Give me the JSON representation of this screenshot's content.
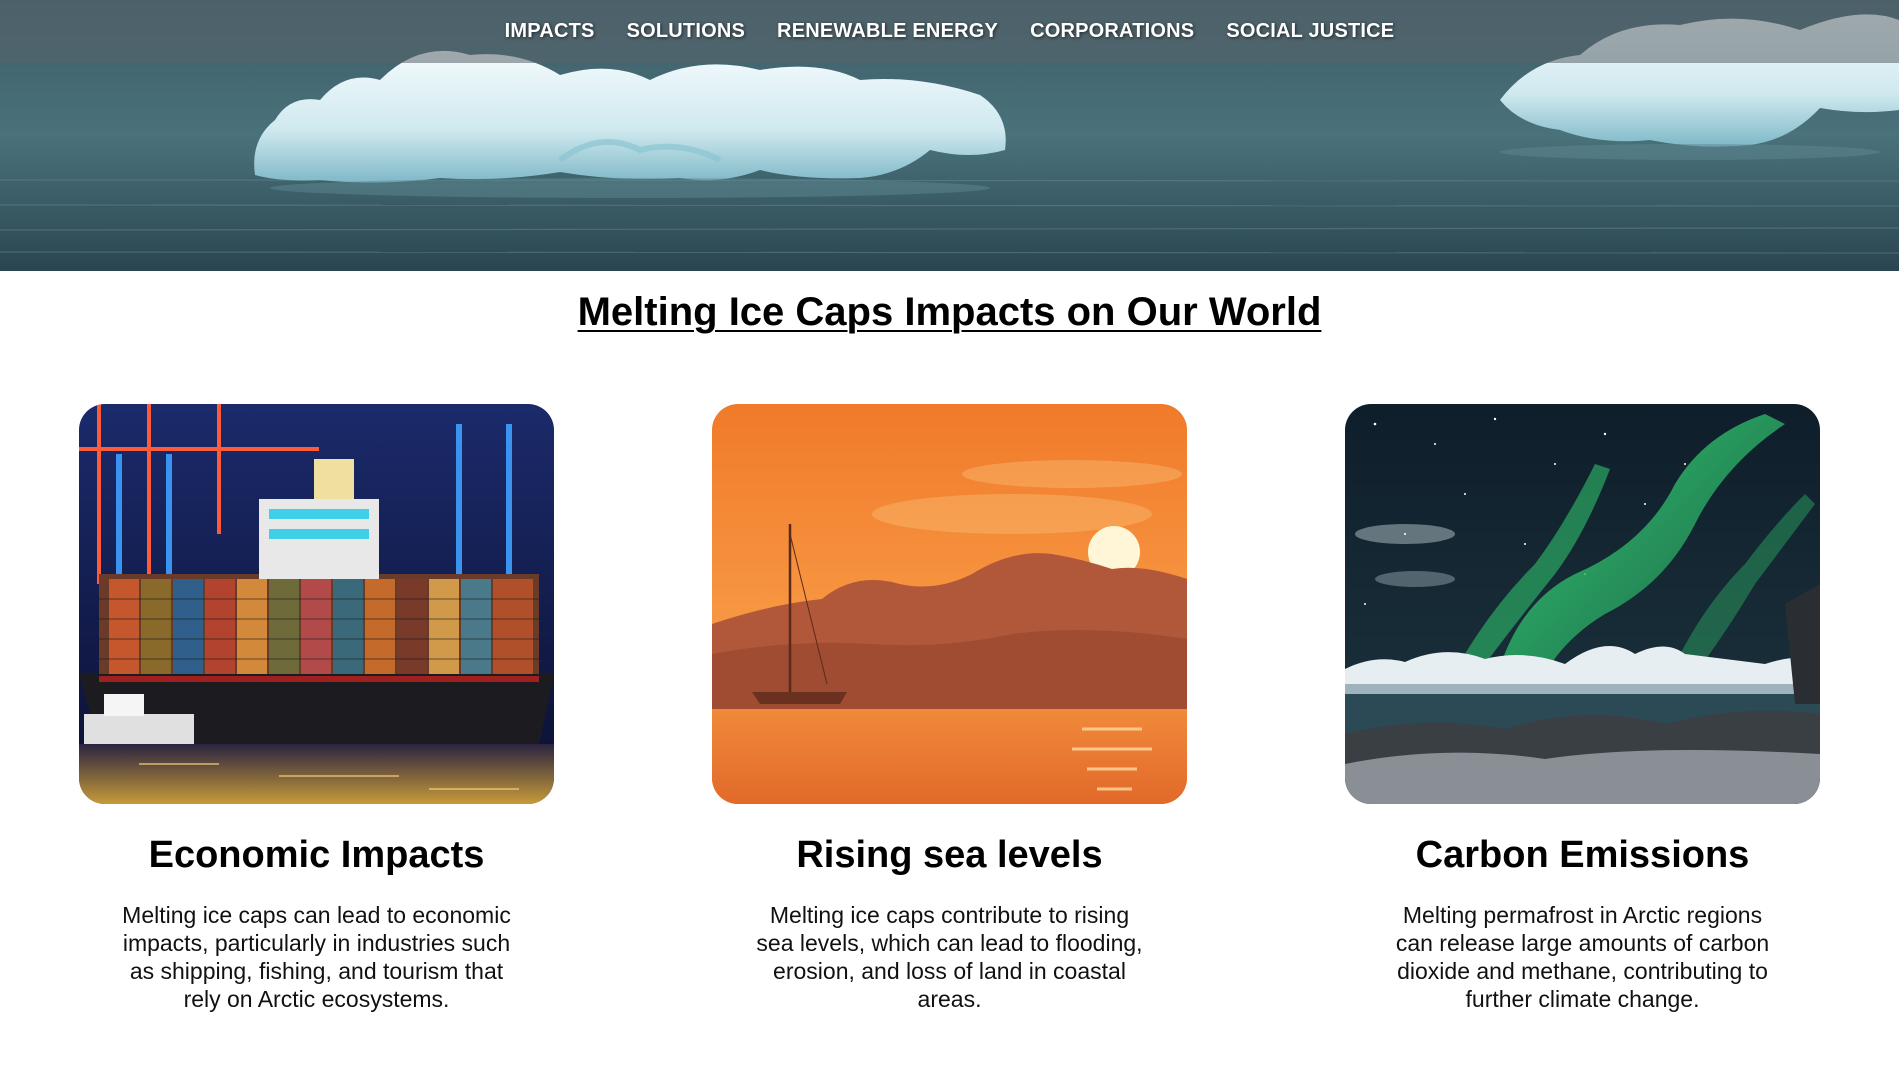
{
  "nav": {
    "items": [
      {
        "label": "IMPACTS"
      },
      {
        "label": "SOLUTIONS"
      },
      {
        "label": "RENEWABLE ENERGY"
      },
      {
        "label": "CORPORATIONS"
      },
      {
        "label": "SOCIAL JUSTICE"
      }
    ]
  },
  "hero": {
    "image": "arctic-sea-ice-photo"
  },
  "main": {
    "title": "Melting Ice Caps Impacts on Our World",
    "cards": [
      {
        "image": "container-ship-photo",
        "title": "Economic Impacts",
        "text": "Melting ice caps can lead to economic impacts, particularly in industries such as shipping, fishing, and tourism that rely on Arctic ecosystems."
      },
      {
        "image": "sunset-sailboat-photo",
        "title": "Rising sea levels",
        "text": "Melting ice caps contribute to rising sea levels, which can lead to flooding, erosion, and loss of land in coastal areas."
      },
      {
        "image": "aurora-arctic-photo",
        "title": "Carbon Emissions",
        "text": "Melting permafrost in Arctic regions can release large amounts of carbon dioxide and methane, contributing to further climate change."
      }
    ]
  },
  "colors": {
    "nav_text": "#ffffff",
    "heading": "#000000",
    "body_text": "#111111"
  }
}
